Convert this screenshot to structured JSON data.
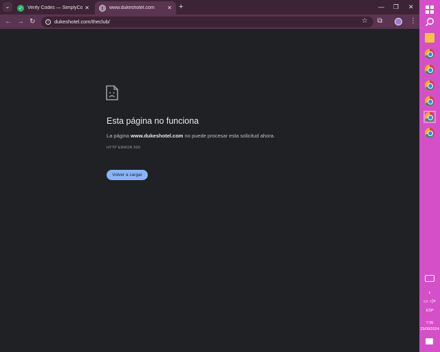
{
  "tabs": [
    {
      "title": "Verify Codes — SimplyCodes",
      "favicon": "simplycodes-check-icon",
      "active": false
    },
    {
      "title": "www.dukeshotel.com",
      "favicon": "globe-icon",
      "active": true
    }
  ],
  "toolbar": {
    "url": "dukeshotel.com/theclub/"
  },
  "error_page": {
    "title": "Esta página no funciona",
    "desc_prefix": "La página ",
    "desc_domain": "www.dukeshotel.com",
    "desc_suffix": " no puede procesar esta solicitud ahora.",
    "code": "HTTP ERROR 500",
    "reload_label": "Volver a cargar"
  },
  "taskbar": {
    "lang": "ESP",
    "time": "7:36",
    "date": "23/08/2024"
  },
  "colors": {
    "tabbar": "#3c2436",
    "toolbar": "#5a3450",
    "page_bg": "#202124",
    "taskbar": "#d54fc8",
    "button": "#8ab4f8"
  }
}
